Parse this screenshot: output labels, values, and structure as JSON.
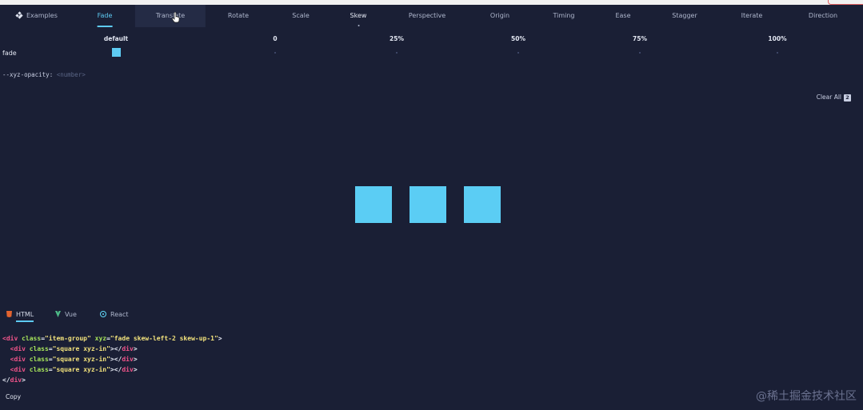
{
  "nav": {
    "examples": "Examples",
    "items": [
      "Fade",
      "Translate",
      "Rotate",
      "Scale",
      "Skew",
      "Perspective",
      "Origin",
      "Timing",
      "Ease",
      "Stagger",
      "Iterate",
      "Direction"
    ],
    "active": "Fade",
    "hovered": "Translate"
  },
  "property_table": {
    "headers": [
      "default",
      "0",
      "25%",
      "50%",
      "75%",
      "100%"
    ],
    "row_label": "fade"
  },
  "variable": {
    "name": "--xyz-opacity:",
    "type": "<number>"
  },
  "clear_all": {
    "label": "Clear All",
    "count": "2"
  },
  "demo": {
    "square_color": "#5bcdf4",
    "square_count": 3
  },
  "code_tabs": [
    "HTML",
    "Vue",
    "React"
  ],
  "code": {
    "line1": {
      "tag_open": "<div",
      "attr1": "class",
      "val1": "\"item-group\"",
      "attr2": "xyz",
      "val2": "\"fade skew-left-2 skew-up-1\"",
      "close": ">"
    },
    "inner_lines": [
      {
        "tag_open": "<div",
        "attr": "class",
        "val": "\"square xyz-in\"",
        "mid": "></",
        "tag_name": "div",
        "close": ">"
      },
      {
        "tag_open": "<div",
        "attr": "class",
        "val": "\"square xyz-in\"",
        "mid": "></",
        "tag_name": "div",
        "close": ">"
      },
      {
        "tag_open": "<div",
        "attr": "class",
        "val": "\"square xyz-in\"",
        "mid": "></",
        "tag_name": "div",
        "close": ">"
      }
    ],
    "last_line": {
      "open": "</",
      "tag_name": "div",
      "close": ">"
    }
  },
  "copy_label": "Copy",
  "watermark": "@稀土掘金技术社区",
  "colors": {
    "background": "#1a1f35",
    "accent": "#5ecbf3",
    "tag": "#f0548a",
    "attr": "#a6e35a",
    "string": "#f2e27c"
  }
}
